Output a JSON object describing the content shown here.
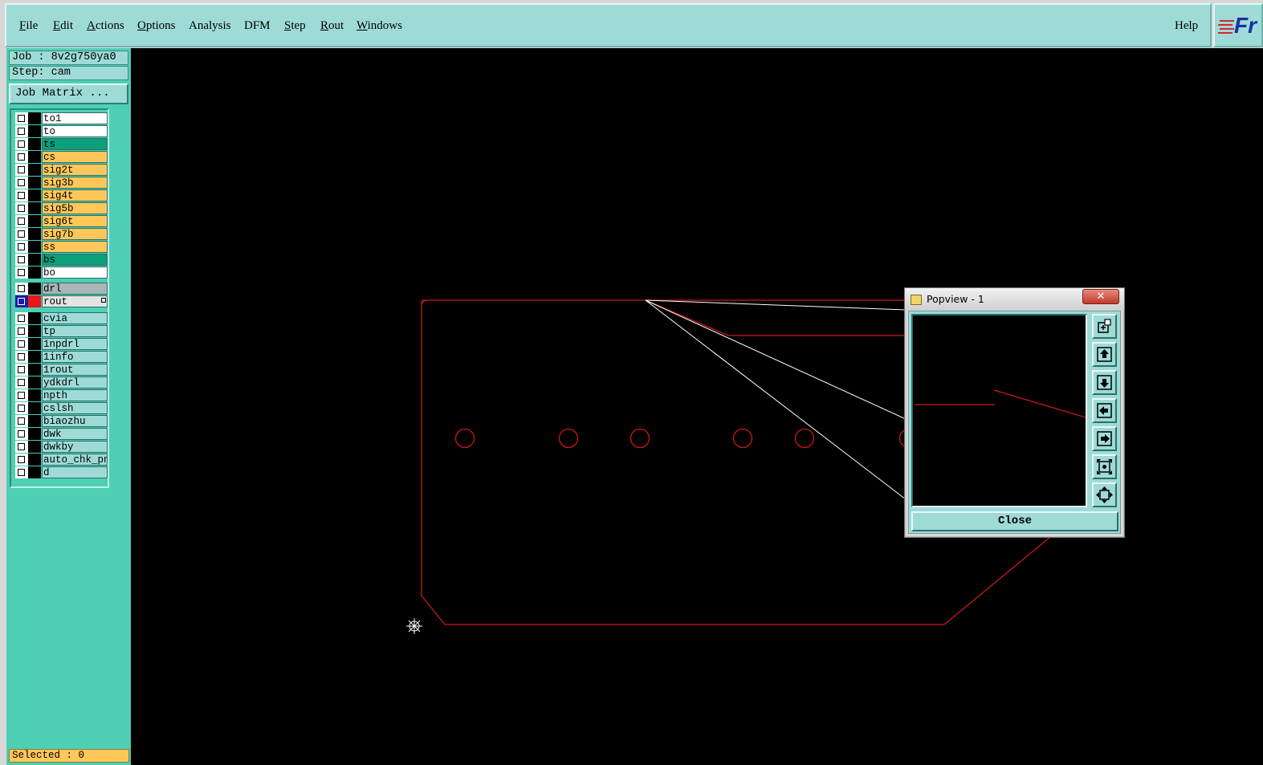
{
  "menu": {
    "items": [
      {
        "label": "File",
        "u": "F",
        "rest": "ile"
      },
      {
        "label": "Edit",
        "u": "E",
        "rest": "dit"
      },
      {
        "label": "Actions",
        "u": "A",
        "rest": "ctions"
      },
      {
        "label": "Options",
        "u": "O",
        "rest": "ptions"
      },
      {
        "label": "Analysis",
        "u": "",
        "rest": "Analysis"
      },
      {
        "label": "DFM",
        "u": "",
        "rest": "DFM"
      },
      {
        "label": "Step",
        "u": "S",
        "rest": "tep"
      },
      {
        "label": "Rout",
        "u": "R",
        "rest": "out"
      },
      {
        "label": "Windows",
        "u": "W",
        "rest": "indows"
      }
    ],
    "help": "Help",
    "logo": "Fr"
  },
  "job": {
    "job_text": "Job : 8v2g750ya0",
    "step_text": "Step: cam",
    "matrix_button": "Job Matrix ..."
  },
  "layers": {
    "board": [
      {
        "name": "to1",
        "color": "#ffffff"
      },
      {
        "name": "to",
        "color": "#ffffff"
      },
      {
        "name": "ts",
        "color": "#0b9f7a"
      },
      {
        "name": "cs",
        "color": "#ffc75a"
      },
      {
        "name": "sig2t",
        "color": "#ffc75a"
      },
      {
        "name": "sig3b",
        "color": "#ffc75a"
      },
      {
        "name": "sig4t",
        "color": "#ffc75a"
      },
      {
        "name": "sig5b",
        "color": "#ffc75a"
      },
      {
        "name": "sig6t",
        "color": "#ffc75a"
      },
      {
        "name": "sig7b",
        "color": "#ffc75a"
      },
      {
        "name": "ss",
        "color": "#ffc75a"
      },
      {
        "name": "bs",
        "color": "#0b9f7a"
      },
      {
        "name": "bo",
        "color": "#ffffff"
      }
    ],
    "drill": [
      {
        "name": "drl",
        "color": "#a9b5b7"
      },
      {
        "name": "rout",
        "color": "#e4e4e4"
      }
    ],
    "misc": [
      {
        "name": "cvia",
        "color": "#9edbd7"
      },
      {
        "name": "tp",
        "color": "#9edbd7"
      },
      {
        "name": "1npdrl",
        "color": "#9edbd7"
      },
      {
        "name": "1info",
        "color": "#9edbd7"
      },
      {
        "name": "1rout",
        "color": "#9edbd7"
      },
      {
        "name": "ydkdrl",
        "color": "#9edbd7"
      },
      {
        "name": "npth",
        "color": "#9edbd7"
      },
      {
        "name": "cslsh",
        "color": "#9edbd7"
      },
      {
        "name": "biaozhu",
        "color": "#9edbd7"
      },
      {
        "name": "dwk",
        "color": "#9edbd7"
      },
      {
        "name": "dwkby",
        "color": "#9edbd7"
      },
      {
        "name": "auto_chk_pnl",
        "color": "#9edbd7"
      },
      {
        "name": "d",
        "color": "#9edbd7"
      }
    ]
  },
  "status": {
    "selected_text": "Selected : 0"
  },
  "popview": {
    "title": "Popview - 1",
    "close_x": "✕",
    "close_label": "Close",
    "tool_icons": [
      "zoom-window-icon",
      "pan-up-icon",
      "pan-down-icon",
      "pan-left-icon",
      "pan-right-icon",
      "zoom-fit-icon",
      "zoom-home-icon"
    ]
  },
  "colors": {
    "panel": "#4fcfb3",
    "menubar": "#9edbd7",
    "outline": "#c81919",
    "highlight": "#ffc75a"
  }
}
